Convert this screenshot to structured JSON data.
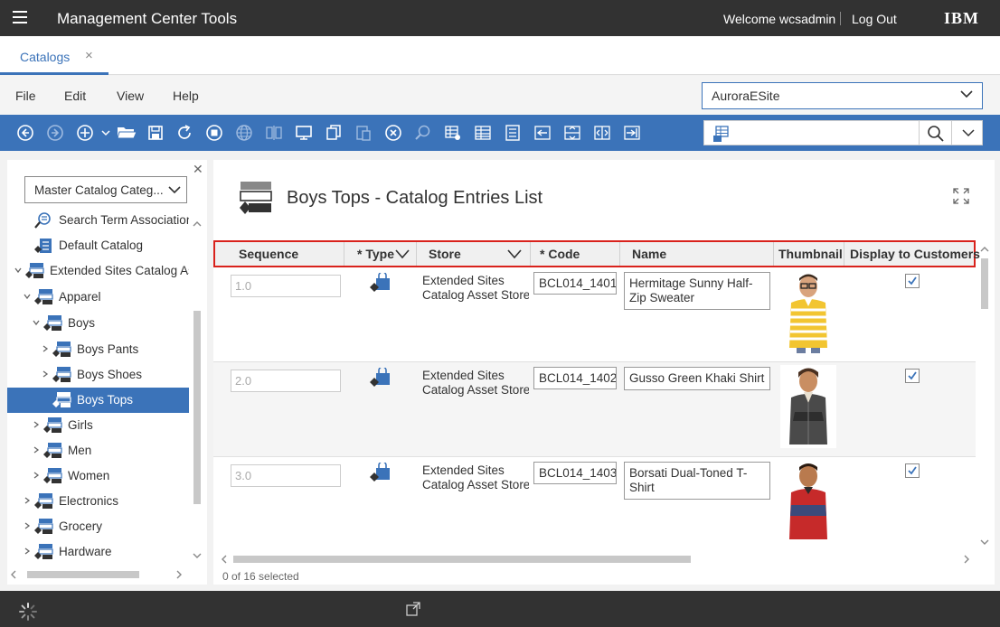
{
  "header": {
    "title": "Management Center Tools",
    "welcome": "Welcome wcsadmin",
    "logout": "Log Out",
    "brand": "IBM"
  },
  "tabs": [
    {
      "label": "Catalogs",
      "close": "×"
    }
  ],
  "menu": {
    "items": [
      "File",
      "Edit",
      "View",
      "Help"
    ],
    "store_select": "AuroraESite"
  },
  "toolbar": {
    "icons": [
      "back-icon",
      "forward-icon",
      "new-icon",
      "open-icon",
      "save-icon",
      "refresh-icon",
      "stop-icon",
      "globe-icon",
      "compare-icon",
      "preview-icon",
      "copy-icon",
      "paste-icon",
      "delete-icon",
      "find-icon",
      "grid-config-icon",
      "grid-list-icon",
      "properties-icon",
      "move-left-icon",
      "move-up-down-icon",
      "split-icon",
      "move-right-icon"
    ],
    "search_placeholder": ""
  },
  "left": {
    "filter": "Master Catalog Categ...",
    "tree": [
      {
        "label": "Search Term Associations",
        "icon": "search-term-icon",
        "caret": ""
      },
      {
        "label": "Default Catalog",
        "icon": "catalog-icon",
        "caret": ""
      },
      {
        "label": "Extended Sites Catalog Asset Store",
        "icon": "catalog-category-icon",
        "caret": "open"
      },
      {
        "label": "Apparel",
        "icon": "category-icon",
        "caret": "open"
      },
      {
        "label": "Boys",
        "icon": "category-icon",
        "caret": "open"
      },
      {
        "label": "Boys Pants",
        "icon": "category-icon",
        "caret": "closed"
      },
      {
        "label": "Boys Shoes",
        "icon": "category-icon",
        "caret": "closed"
      },
      {
        "label": "Boys Tops",
        "icon": "category-icon",
        "caret": ""
      },
      {
        "label": "Girls",
        "icon": "category-icon",
        "caret": "closed"
      },
      {
        "label": "Men",
        "icon": "category-icon",
        "caret": "closed"
      },
      {
        "label": "Women",
        "icon": "category-icon",
        "caret": "closed"
      },
      {
        "label": "Electronics",
        "icon": "category-icon",
        "caret": "closed"
      },
      {
        "label": "Grocery",
        "icon": "category-icon",
        "caret": "closed"
      },
      {
        "label": "Hardware",
        "icon": "category-icon",
        "caret": "closed"
      }
    ]
  },
  "main": {
    "title": "Boys Tops - Catalog Entries List",
    "columns": [
      "Sequence",
      "* Type",
      "Store",
      "* Code",
      "Name",
      "Thumbnail",
      "Display to Customers"
    ],
    "rows": [
      {
        "sequence": "1.0",
        "store": [
          "Extended Sites",
          "Catalog Asset Store"
        ],
        "code": "BCL014_1401",
        "name": "Hermitage Sunny Half-Zip Sweater",
        "checked": true
      },
      {
        "sequence": "2.0",
        "store": [
          "Extended Sites",
          "Catalog Asset Store"
        ],
        "code": "BCL014_1402",
        "name": "Gusso Green Khaki Shirt",
        "checked": true
      },
      {
        "sequence": "3.0",
        "store": [
          "Extended Sites",
          "Catalog Asset Store"
        ],
        "code": "BCL014_1403",
        "name": "Borsati Dual-Toned T-Shirt",
        "checked": true
      }
    ],
    "status": "0 of 16 selected"
  },
  "colors": {
    "accent": "#3b73b9",
    "header_bg": "#323232",
    "highlight_border": "#d9221c"
  }
}
